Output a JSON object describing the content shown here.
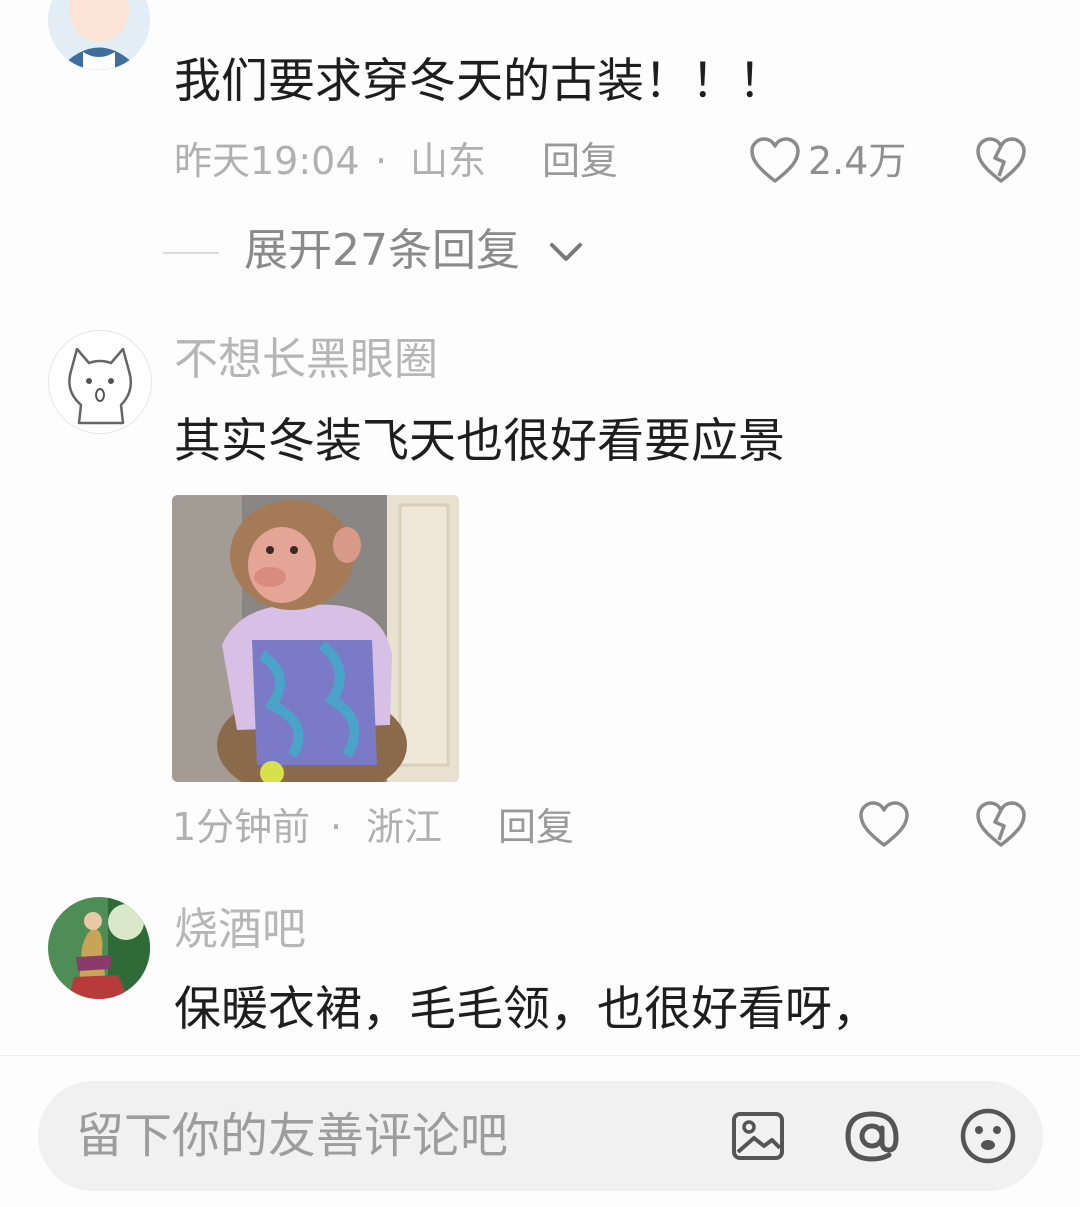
{
  "comments": [
    {
      "text": "我们要求穿冬天的古装！！！",
      "time": "昨天19:04",
      "location": "山东",
      "reply_label": "回复",
      "likes": "2.4万"
    },
    {
      "username": "不想长黑眼圈",
      "text": "其实冬装飞天也很好看要应景",
      "time": "1分钟前",
      "location": "浙江",
      "reply_label": "回复",
      "likes": ""
    },
    {
      "username": "烧酒吧",
      "text": "保暖衣裙，毛毛领，也很好看呀，"
    }
  ],
  "expand_replies": "展开27条回复",
  "meta_separator": "·",
  "input": {
    "placeholder": "留下你的友善评论吧"
  },
  "icons": {
    "like": "heart-outline-icon",
    "dislike": "broken-heart-icon",
    "expand": "chevron-down-icon",
    "image": "image-icon",
    "mention": "at-icon",
    "emoji": "emoji-icon"
  },
  "colors": {
    "username": "#b6b6b6",
    "text": "#1e1e1e",
    "meta": "#b0b0b0",
    "input_bg": "#f1f1f1"
  }
}
